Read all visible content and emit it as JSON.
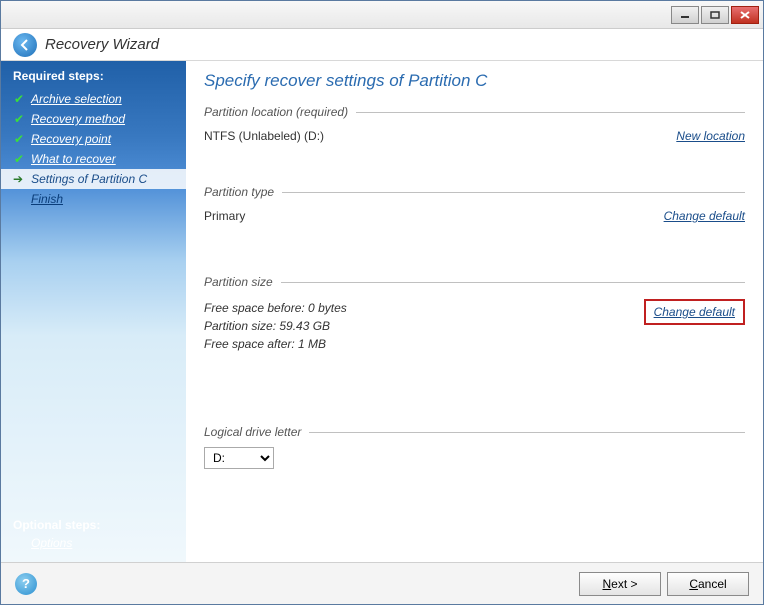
{
  "header": {
    "title": "Recovery Wizard"
  },
  "sidebar": {
    "required_title": "Required steps:",
    "steps": [
      {
        "label": "Archive selection"
      },
      {
        "label": "Recovery method"
      },
      {
        "label": "Recovery point"
      },
      {
        "label": "What to recover"
      },
      {
        "label": "Settings of Partition C"
      },
      {
        "label": "Finish"
      }
    ],
    "optional_title": "Optional steps:",
    "optional_link": "Options"
  },
  "main": {
    "title": "Specify recover settings of Partition C",
    "location": {
      "label": "Partition location (required)",
      "value": "NTFS (Unlabeled) (D:)",
      "link": "New location"
    },
    "type": {
      "label": "Partition type",
      "value": "Primary",
      "link": "Change default"
    },
    "size": {
      "label": "Partition size",
      "free_before": "Free space before: 0 bytes",
      "part_size": "Partition size: 59.43 GB",
      "free_after": "Free space after: 1 MB",
      "link": "Change default"
    },
    "drive": {
      "label": "Logical drive letter",
      "value": "D:"
    }
  },
  "footer": {
    "next": "Next >",
    "cancel": "Cancel"
  }
}
